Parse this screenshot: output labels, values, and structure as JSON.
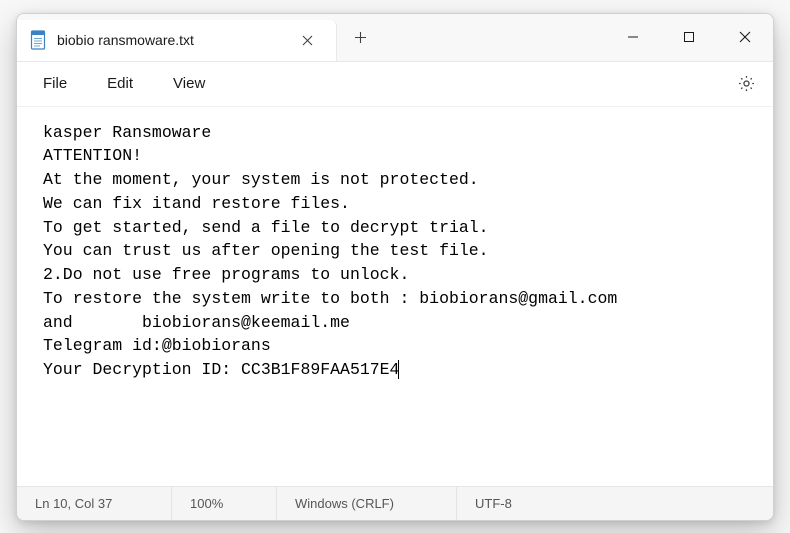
{
  "tab": {
    "title": "biobio ransmoware.txt",
    "icon": "notepad-icon"
  },
  "menubar": {
    "file": "File",
    "edit": "Edit",
    "view": "View"
  },
  "content": {
    "lines": [
      "kasper Ransmoware",
      "ATTENTION!",
      "At the moment, your system is not protected.",
      "We can fix itand restore files.",
      "To get started, send a file to decrypt trial.",
      "You can trust us after opening the test file.",
      "2.Do not use free programs to unlock.",
      "To restore the system write to both : biobiorans@gmail.com",
      "and       biobiorans@keemail.me",
      "Telegram id:@biobiorans",
      "Your Decryption ID: CC3B1F89FAA517E4"
    ]
  },
  "statusbar": {
    "position": "Ln 10, Col 37",
    "zoom": "100%",
    "eol": "Windows (CRLF)",
    "encoding": "UTF-8"
  }
}
